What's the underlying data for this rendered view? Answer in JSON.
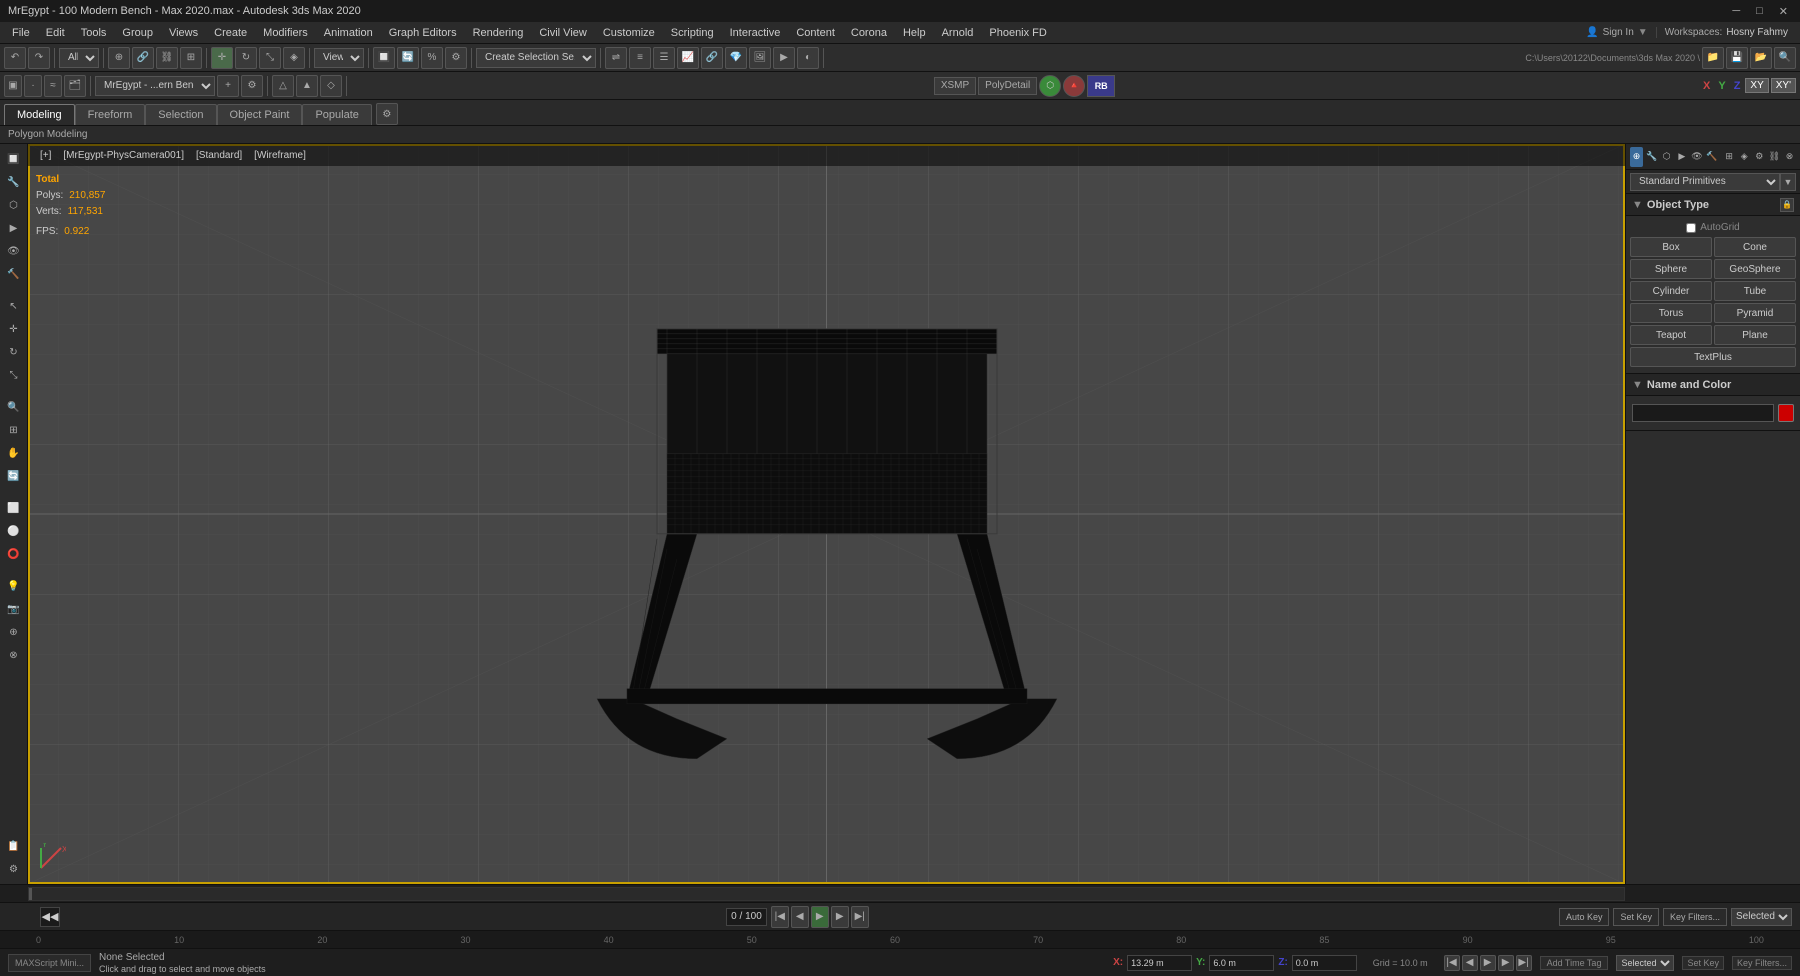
{
  "titlebar": {
    "title": "MrEgypt - 100 Modern Bench - Max 2020.max - Autodesk 3ds Max 2020",
    "min": "─",
    "restore": "□",
    "close": "✕"
  },
  "menu": {
    "items": [
      "File",
      "Edit",
      "Tools",
      "Group",
      "Views",
      "Create",
      "Modifiers",
      "Animation",
      "Graph Editors",
      "Rendering",
      "Civil View",
      "Customize",
      "Scripting",
      "Interactive",
      "Content",
      "Corona",
      "Help",
      "Arnold",
      "Phoenix FD"
    ]
  },
  "toolbar1": {
    "items": [
      "All",
      "View",
      "Create Selection Se..."
    ]
  },
  "tabs": {
    "items": [
      "Modeling",
      "Freeform",
      "Selection",
      "Object Paint",
      "Populate"
    ],
    "active": "Modeling"
  },
  "sub_label": "Polygon Modeling",
  "viewport": {
    "header": "[+] [MrEgypt-PhysCamera001] [Standard] [Wireframe]",
    "header_parts": [
      "[+]",
      "[MrEgypt-PhysCamera001]",
      "[Standard]",
      "[Wireframe]"
    ]
  },
  "stats": {
    "total_label": "Total",
    "polys_label": "Polys:",
    "polys_value": "210,857",
    "verts_label": "Verts:",
    "verts_value": "117,531",
    "fps_label": "FPS:",
    "fps_value": "0.922"
  },
  "right_panel": {
    "dropdown": "Standard Primitives",
    "object_type": {
      "header": "Object Type",
      "autogrid": "AutoGrid",
      "buttons": [
        "Box",
        "Cone",
        "Sphere",
        "GeoSphere",
        "Cylinder",
        "Tube",
        "Torus",
        "Pyramid",
        "Teapot",
        "Plane",
        "TextPlus"
      ]
    },
    "name_color": {
      "header": "Name and Color",
      "placeholder": ""
    }
  },
  "timeline": {
    "frame": "0 / 100",
    "ticks": [
      "0",
      "10",
      "20",
      "30",
      "40",
      "50",
      "60",
      "70",
      "80",
      "90",
      "100"
    ]
  },
  "statusbar": {
    "none_selected": "None Selected",
    "hint": "Click and drag to select and move objects"
  },
  "coords": {
    "x_label": "X:",
    "x_value": "13.29 m",
    "y_label": "Y:",
    "y_value": "6.0 m",
    "z_label": "Z:",
    "z_value": "0.0 m",
    "grid": "Grid = 10.0 m"
  },
  "playback": {
    "selected_label": "Selected",
    "auto_key": "Auto Key",
    "set_key": "Set Key",
    "key_filters": "Key Filters..."
  },
  "maxscript": {
    "label": "MAXScript",
    "content": "MAXScript Mini..."
  },
  "workspaces": {
    "label": "Workspaces:",
    "value": "Hosny Fahmy"
  },
  "signin": {
    "label": "Sign In"
  }
}
